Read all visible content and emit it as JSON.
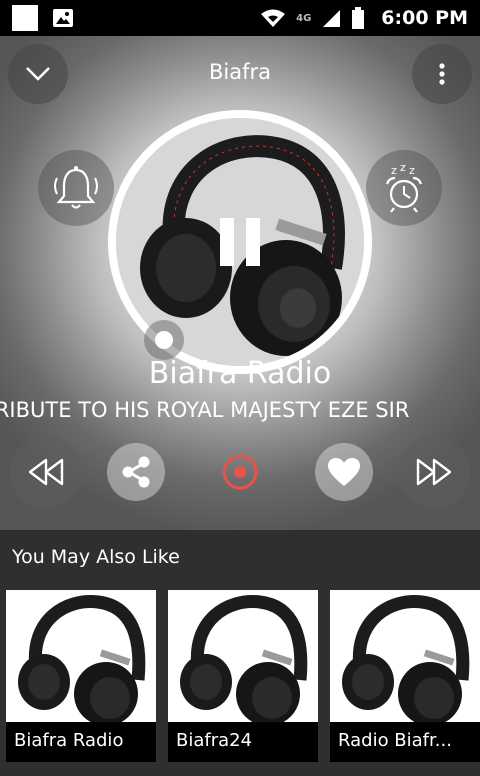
{
  "status_bar": {
    "time": "6:00 PM",
    "network": "4G",
    "icons": [
      "notification-square-icon",
      "image-icon",
      "wifi-icon",
      "signal-icon",
      "battery-icon"
    ]
  },
  "header": {
    "title": "Biafra",
    "collapse_icon": "chevron-down-icon",
    "menu_icon": "more-vert-icon"
  },
  "player": {
    "station_name": "Biafra Radio",
    "now_playing": "TRIBUTE TO HIS ROYAL MAJESTY EZE SIR",
    "alarm_icon": "bell-icon",
    "sleep_icon": "sleep-alarm-icon",
    "playback_icon": "pause-icon",
    "controls": [
      "rewind-icon",
      "share-icon",
      "record-icon",
      "heart-icon",
      "fast-forward-icon"
    ],
    "accent_color": "#e8534a"
  },
  "recommendations": {
    "title": "You May Also Like",
    "items": [
      {
        "label": "Biafra Radio"
      },
      {
        "label": "Biafra24"
      },
      {
        "label": "Radio Biafr..."
      }
    ]
  }
}
